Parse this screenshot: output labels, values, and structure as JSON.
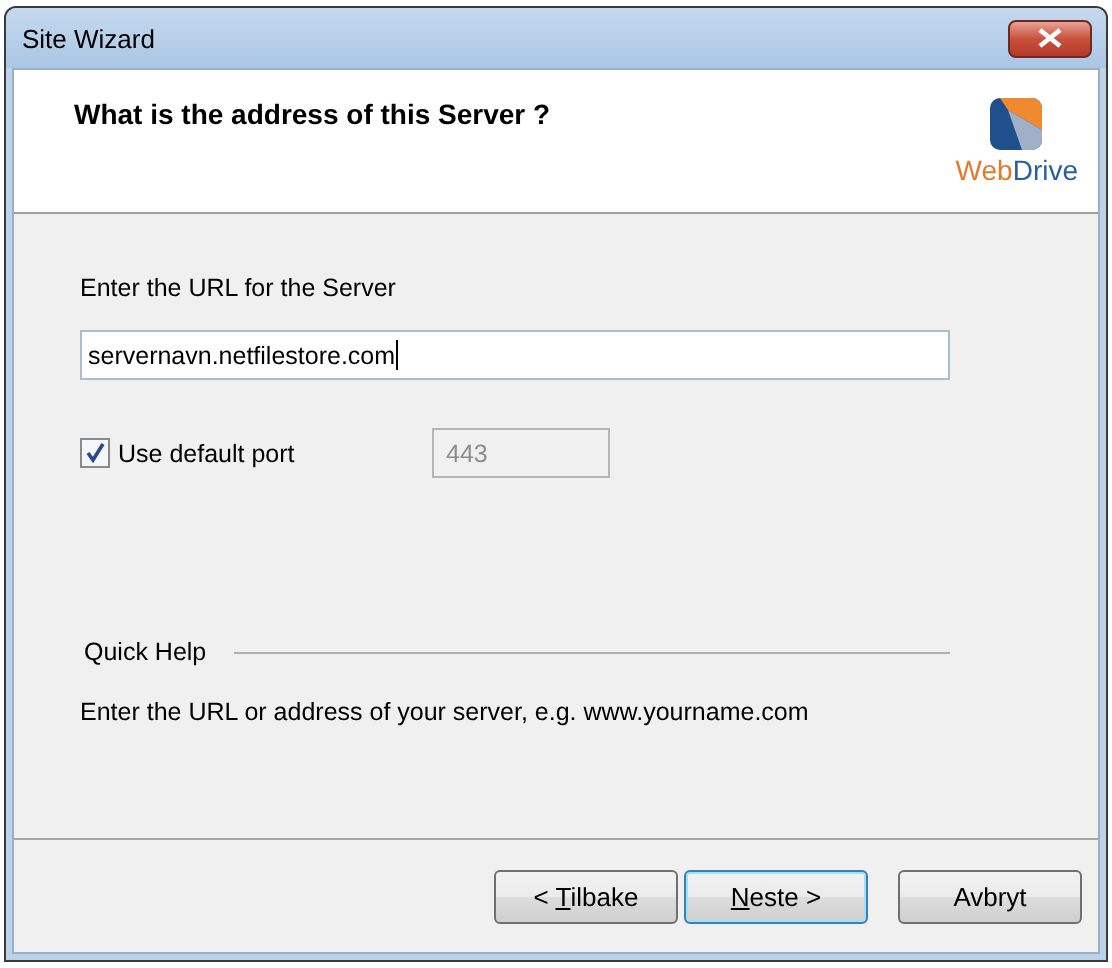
{
  "window": {
    "title": "Site Wizard"
  },
  "header": {
    "title": "What is the address of this Server ?",
    "logo": {
      "first": "Web",
      "second": "Drive"
    }
  },
  "url": {
    "label": "Enter the URL for the Server",
    "value": "servernavn.netfilestore.com",
    "focused": true
  },
  "default_port": {
    "label": "Use default port",
    "checked": true
  },
  "port": {
    "value": "443",
    "disabled": true
  },
  "quick_help": {
    "title": "Quick Help",
    "text": "Enter the URL or address of your server, e.g. www.yourname.com"
  },
  "buttons": [
    {
      "before": "< ",
      "key": "T",
      "after": "ilbake",
      "default": false
    },
    {
      "key": "N",
      "after": "este >",
      "default": true
    },
    {
      "after": "Avbryt",
      "default": false
    }
  ]
}
